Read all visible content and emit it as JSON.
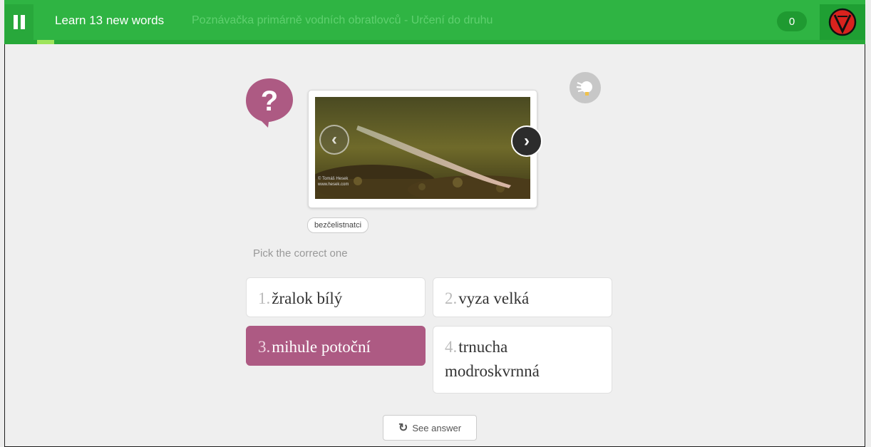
{
  "header": {
    "title": "Learn 13 new words",
    "course": "Poznávačka primárně vodních obratlovců - Určení do druhu",
    "score": "0",
    "progress": 0.02
  },
  "media": {
    "watermark_line1": "© Tomáš Hesek",
    "watermark_line2": "www.hesek.com"
  },
  "tag": "bezčelistnatci",
  "prompt": "Pick the correct one",
  "options": [
    {
      "num": "1.",
      "label": "žralok bílý"
    },
    {
      "num": "2.",
      "label": "vyza velká"
    },
    {
      "num": "3.",
      "label": "mihule potoční"
    },
    {
      "num": "4.",
      "label": "trnucha modroskvrnná"
    }
  ],
  "see_answer": "See answer",
  "colors": {
    "brand_green": "#2fb443",
    "selected": "#ad5a83"
  },
  "icons": {
    "pause": "pause-icon",
    "question": "question-bubble-icon",
    "hint": "hint-icon",
    "prev": "chevron-left-icon",
    "next": "chevron-right-icon",
    "refresh": "refresh-icon",
    "avatar": "avatar"
  }
}
